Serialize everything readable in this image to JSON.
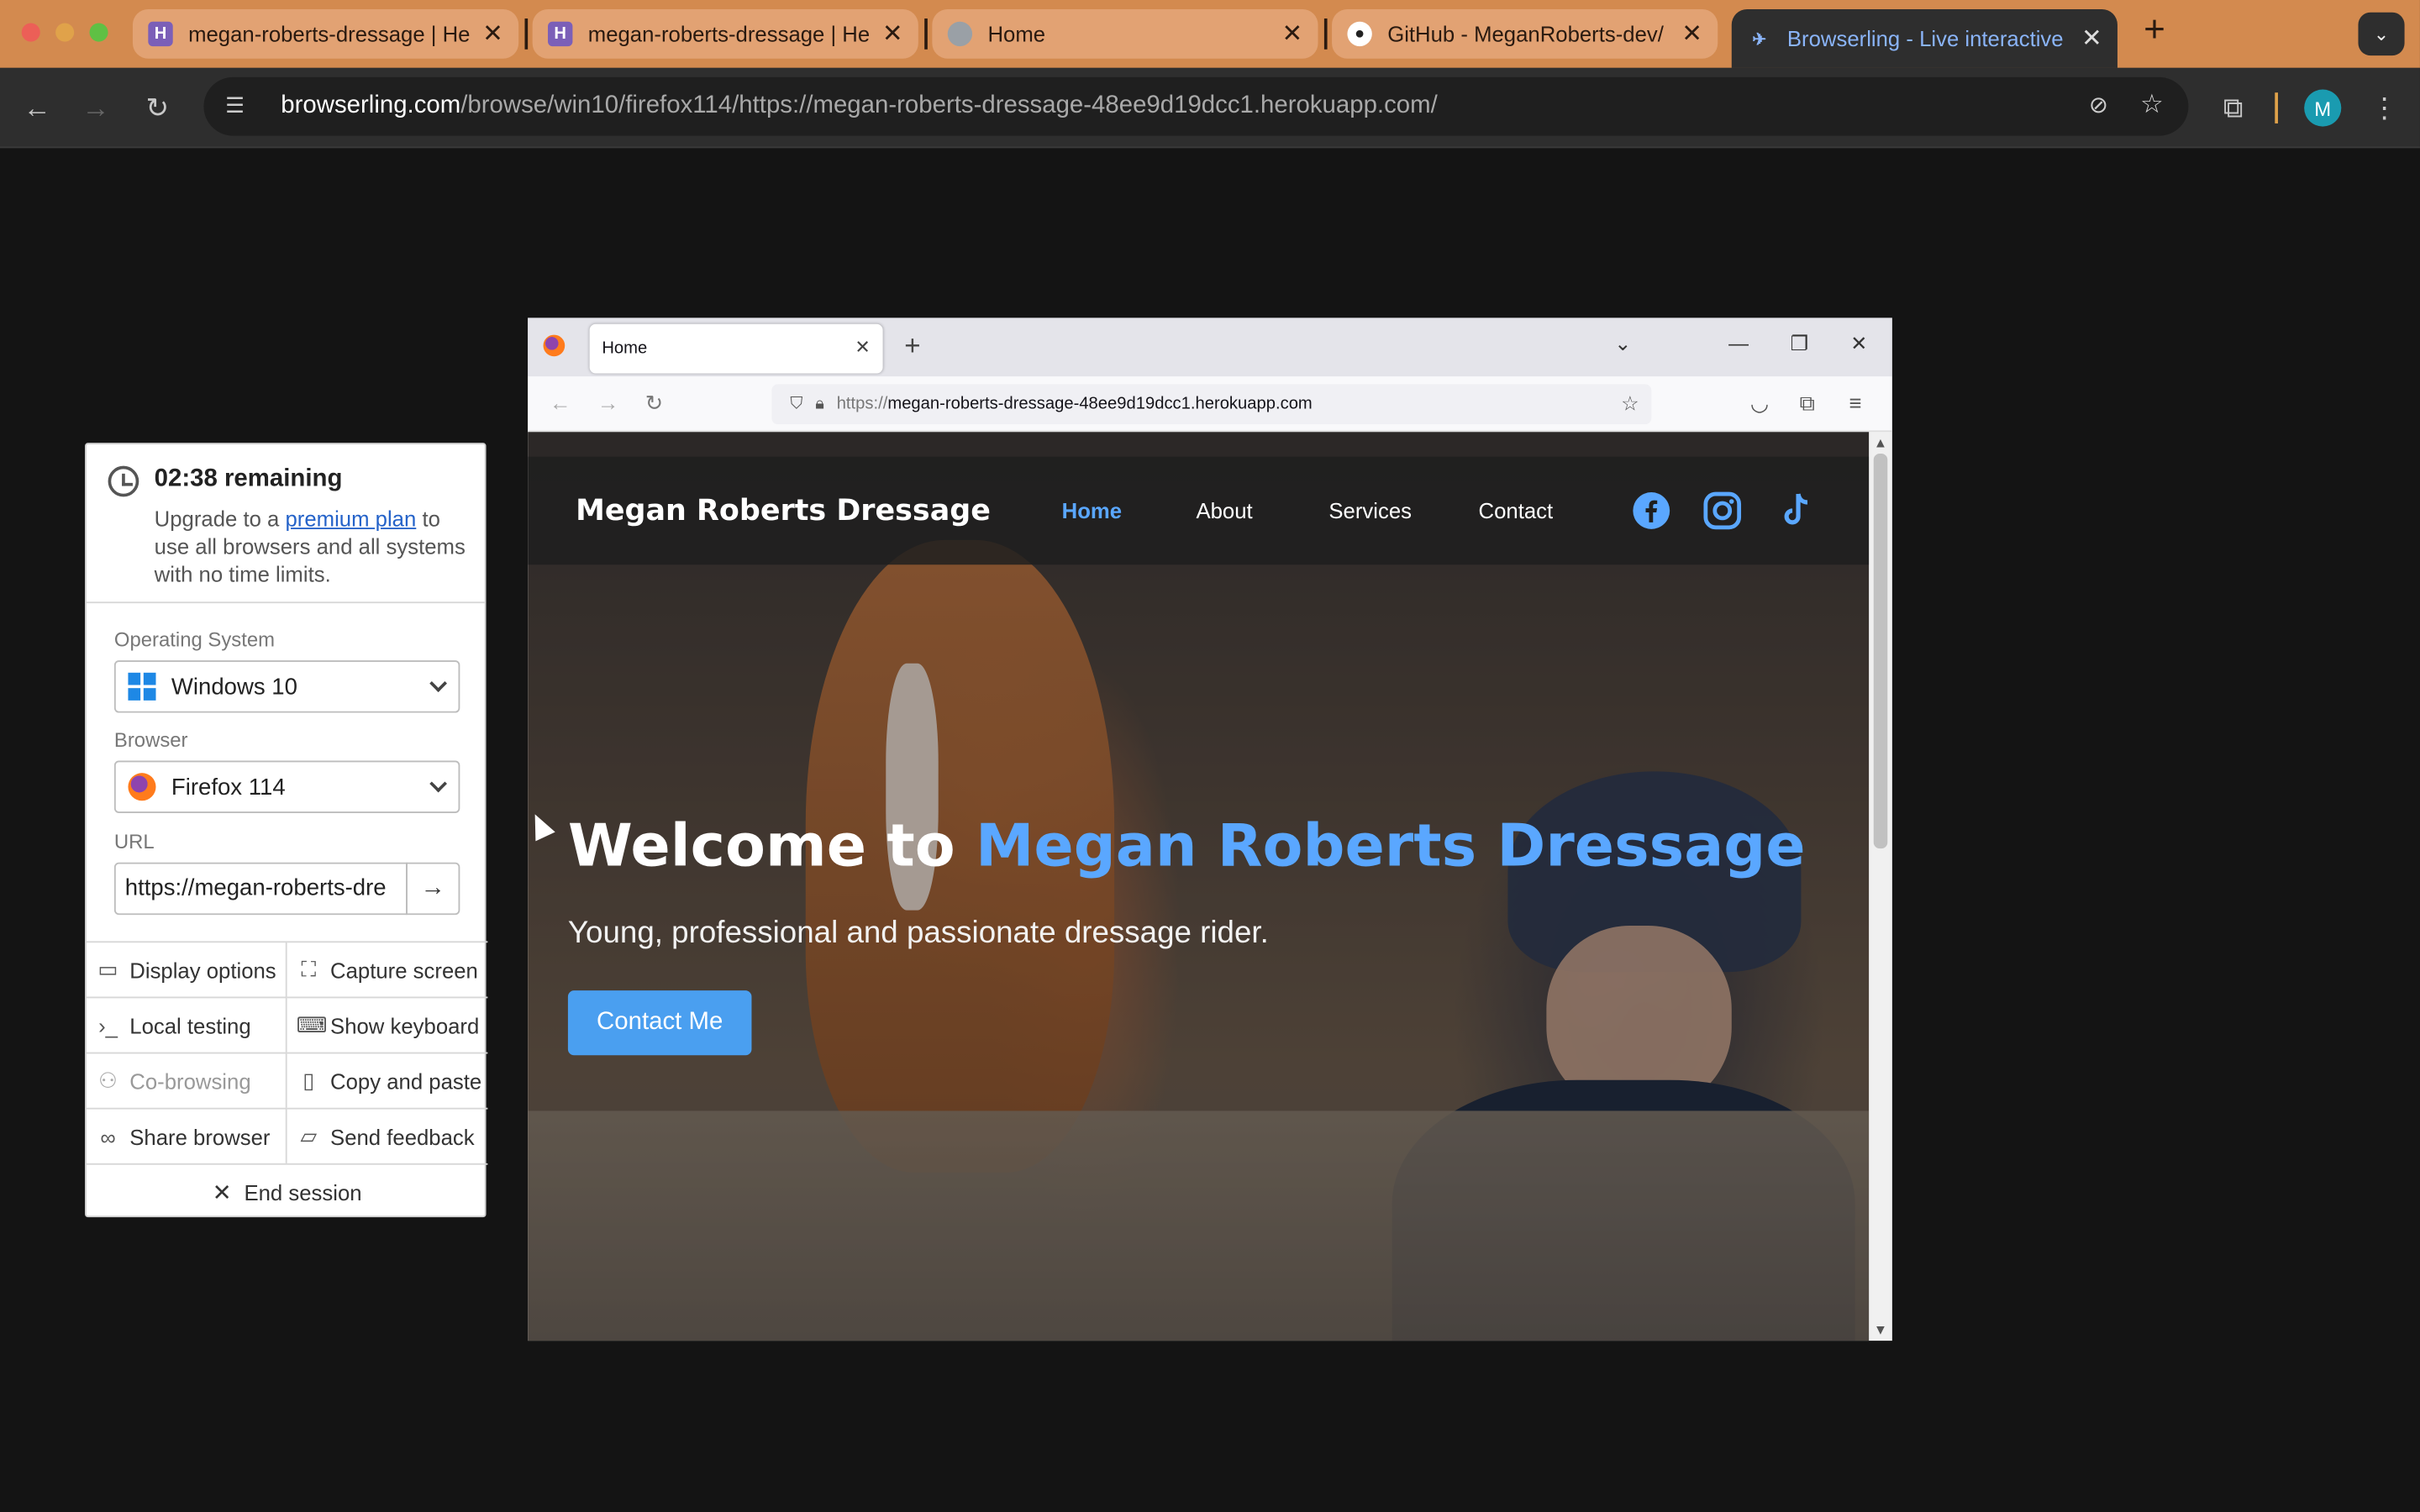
{
  "chrome": {
    "tabs": [
      {
        "title": "megan-roberts-dressage | He",
        "favicon": "heroku-icon"
      },
      {
        "title": "megan-roberts-dressage | He",
        "favicon": "heroku-icon"
      },
      {
        "title": "Home",
        "favicon": "globe-icon"
      },
      {
        "title": "GitHub - MeganRoberts-dev/",
        "favicon": "github-icon"
      },
      {
        "title": "Browserling - Live interactive",
        "favicon": "browserling-icon",
        "active": true
      }
    ],
    "address": {
      "host": "browserling.com",
      "path": "/browse/win10/firefox114/https://megan-roberts-dressage-48ee9d19dcc1.herokuapp.com/"
    },
    "profile_initial": "M"
  },
  "panel": {
    "timer": {
      "remaining": "02:38 remaining",
      "text_before": "Upgrade to a ",
      "link": "premium plan",
      "text_after": " to use all browsers and all systems with no time limits."
    },
    "os_label": "Operating System",
    "os_value": "Windows 10",
    "browser_label": "Browser",
    "browser_value": "Firefox 114",
    "url_label": "URL",
    "url_value": "https://megan-roberts-dre",
    "actions": [
      {
        "label": "Display options",
        "icon": "monitor-icon"
      },
      {
        "label": "Capture screen",
        "icon": "capture-icon"
      },
      {
        "label": "Local testing",
        "icon": "terminal-icon"
      },
      {
        "label": "Show keyboard",
        "icon": "keyboard-icon"
      },
      {
        "label": "Co-browsing",
        "icon": "users-icon",
        "disabled": true
      },
      {
        "label": "Copy and paste",
        "icon": "clipboard-icon"
      },
      {
        "label": "Share browser",
        "icon": "link-icon"
      },
      {
        "label": "Send feedback",
        "icon": "comment-icon"
      }
    ],
    "end_session": "End session"
  },
  "firefox": {
    "tab_title": "Home",
    "url_prefix": "https://",
    "url_domain": "megan-roberts-dressage-48ee9d19dcc1.herokuapp.com"
  },
  "site": {
    "brand": "Megan Roberts Dressage",
    "nav": [
      "Home",
      "About",
      "Services",
      "Contact"
    ],
    "hero_title_prefix": "Welcome to ",
    "hero_title_accent": "Megan Roberts Dressage",
    "hero_subtitle": "Young, professional and passionate dressage rider.",
    "cta": "Contact Me",
    "accent_color": "#5aa7ff"
  }
}
